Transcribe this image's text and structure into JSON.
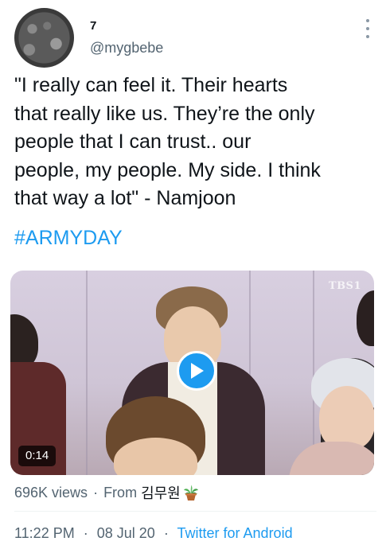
{
  "user": {
    "display_name": "7",
    "handle": "@mygbebe"
  },
  "tweet": {
    "text": "\"I really can feel it. Their hearts\nthat really like us. They’re the only\npeople that I can trust.. our\npeople, my people. My side. I think\nthat way a lot\" - Namjoon",
    "hashtag": "#ARMYDAY"
  },
  "media": {
    "duration": "0:14",
    "watermark": "TBS1",
    "play_icon": "play-icon"
  },
  "meta": {
    "views": "696K views",
    "separator": "·",
    "from_label": "From",
    "source_name": "김무원",
    "source_emoji_icon": "potted-plant-icon"
  },
  "footer": {
    "time": "11:22 PM",
    "separator": "·",
    "date": "08 Jul 20",
    "client": "Twitter for Android"
  },
  "colors": {
    "link_blue": "#1d9bf0",
    "secondary_text": "#536471",
    "primary_text": "#0f1419"
  }
}
